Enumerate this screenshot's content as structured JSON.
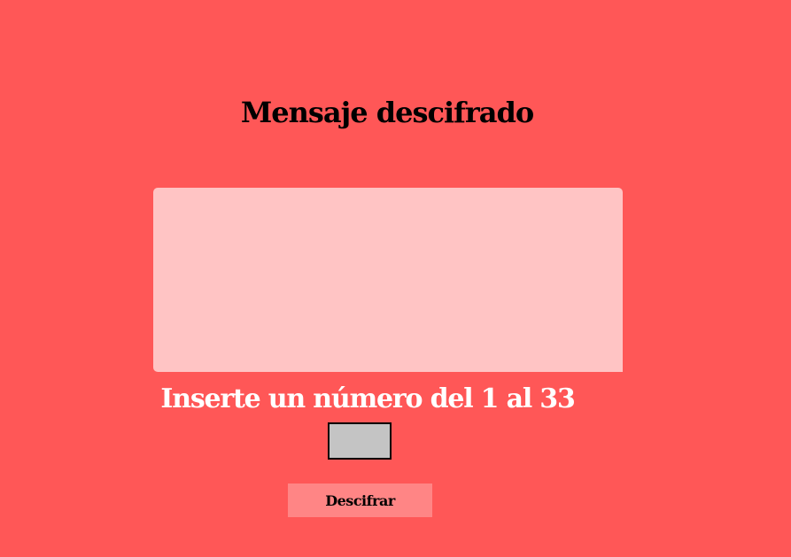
{
  "page": {
    "title": "Mensaje descifrado",
    "background_color": "#FF5757"
  },
  "message": {
    "value": "",
    "background_color": "#FFC4C4"
  },
  "number_prompt": {
    "label": "Inserte un número del 1 al 33",
    "input_value": "",
    "input_background_color": "#C4C4C4"
  },
  "decode_button": {
    "label": "Descifrar",
    "background_color": "#FF8585"
  }
}
